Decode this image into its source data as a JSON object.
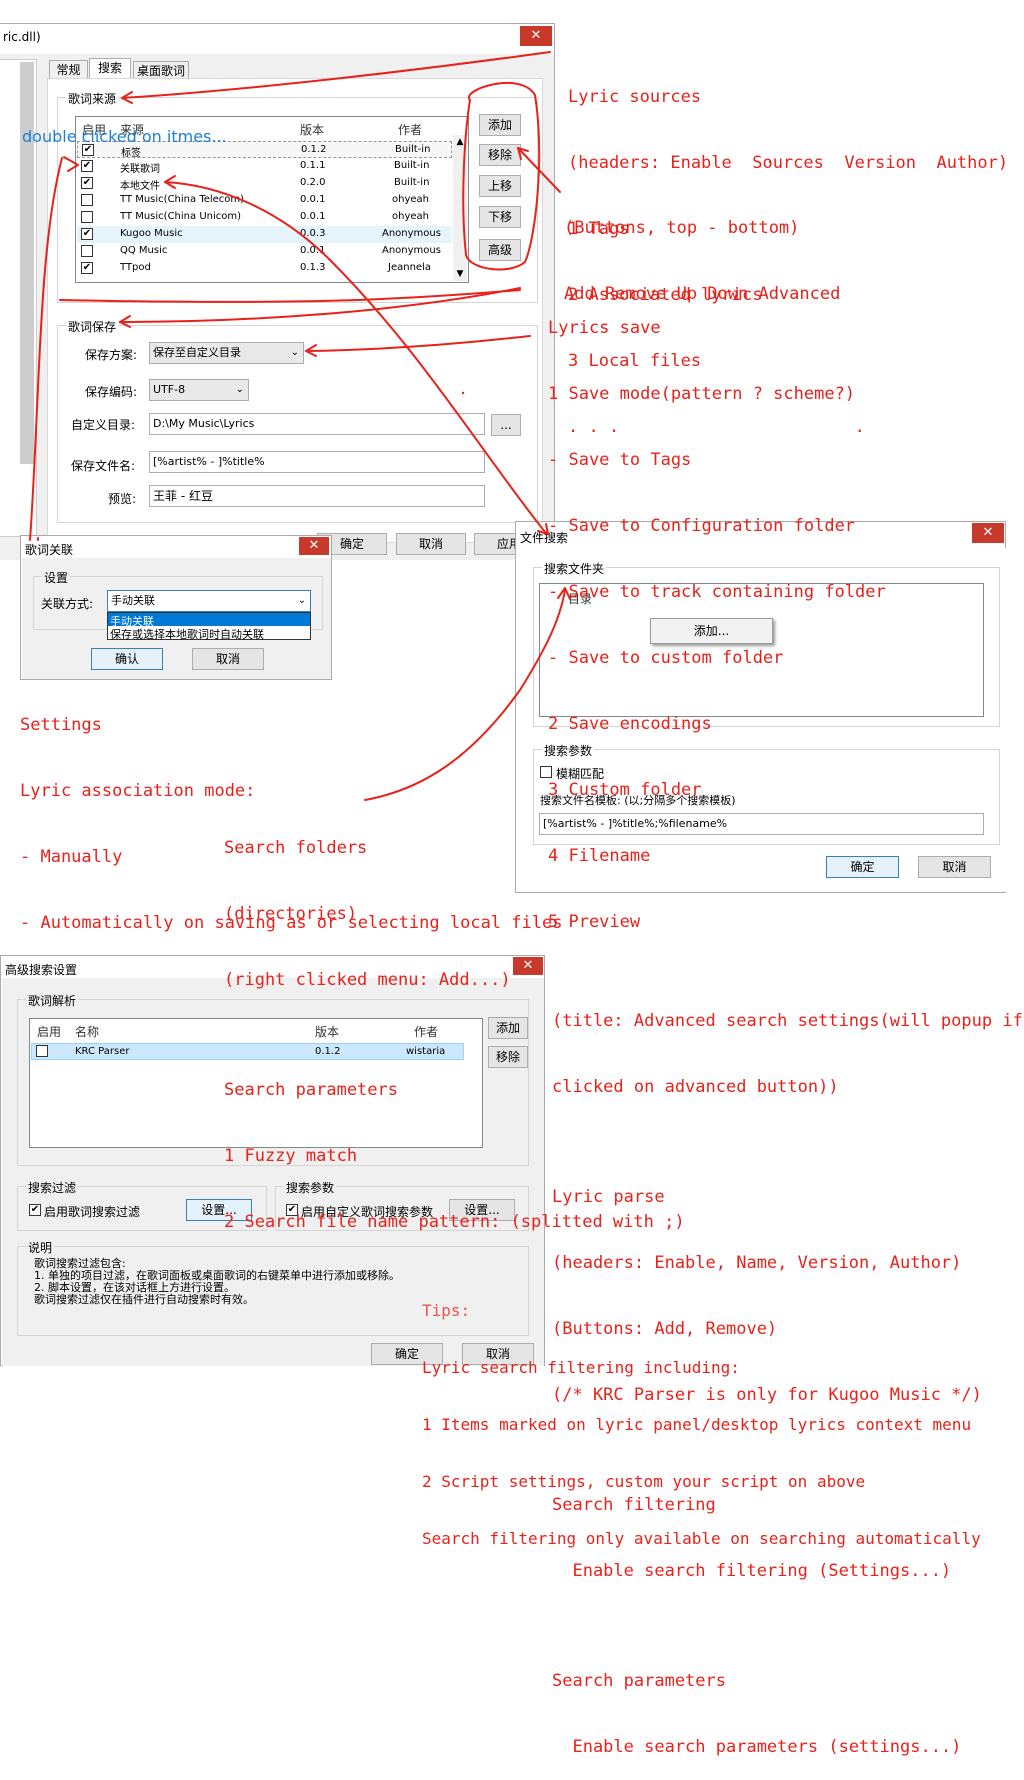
{
  "main_window": {
    "title": "ric.dll)",
    "tabs": [
      "常规",
      "搜索",
      "桌面歌词"
    ],
    "lyric_sources": {
      "group_label": "歌词来源",
      "headers": [
        "启用",
        "来源",
        "版本",
        "作者"
      ],
      "rows": [
        {
          "enabled": true,
          "name": "标签",
          "version": "0.1.2",
          "author": "Built-in"
        },
        {
          "enabled": true,
          "name": "关联歌词",
          "version": "0.1.1",
          "author": "Built-in"
        },
        {
          "enabled": true,
          "name": "本地文件",
          "version": "0.2.0",
          "author": "Built-in"
        },
        {
          "enabled": false,
          "name": "TT Music(China Telecom)",
          "version": "0.0.1",
          "author": "ohyeah"
        },
        {
          "enabled": false,
          "name": "TT Music(China Unicom)",
          "version": "0.0.1",
          "author": "ohyeah"
        },
        {
          "enabled": true,
          "name": "Kugoo Music",
          "version": "0.0.3",
          "author": "Anonymous"
        },
        {
          "enabled": false,
          "name": "QQ Music",
          "version": "0.0.1",
          "author": "Anonymous"
        },
        {
          "enabled": true,
          "name": "TTpod",
          "version": "0.1.3",
          "author": "Jeannela"
        }
      ],
      "buttons": [
        "添加",
        "移除",
        "上移",
        "下移",
        "高级"
      ]
    },
    "lyric_save": {
      "group_label": "歌词保存",
      "scheme_label": "保存方案:",
      "scheme_value": "保存至自定义目录",
      "encoding_label": "保存编码:",
      "encoding_value": "UTF-8",
      "folder_label": "自定义目录:",
      "folder_value": "D:\\My Music\\Lyrics",
      "browse_label": "...",
      "filename_label": "保存文件名:",
      "filename_value": "[%artist% - ]%title%",
      "preview_label": "预览:",
      "preview_value": "王菲 - 红豆"
    },
    "buttons": {
      "ok": "确定",
      "cancel": "取消",
      "apply": "应用"
    }
  },
  "assoc_dialog": {
    "title": "歌词关联",
    "group_label": "设置",
    "mode_label": "关联方式:",
    "mode_value": "手动关联",
    "options": [
      "手动关联",
      "保存或选择本地歌词时自动关联"
    ],
    "ok": "确认",
    "cancel": "取消"
  },
  "file_search_dialog": {
    "title": "文件搜索",
    "folders_group": "搜索文件夹",
    "folders_header": "目录",
    "add_menu": "添加...",
    "params_group": "搜索参数",
    "fuzzy_label": "模糊匹配",
    "pattern_label": "搜索文件名模板: (以;分隔多个搜索模板)",
    "pattern_value": "[%artist% - ]%title%;%filename%",
    "ok": "确定",
    "cancel": "取消"
  },
  "advanced_dialog": {
    "title": "高级搜索设置",
    "parse_group": "歌词解析",
    "headers": [
      "启用",
      "名称",
      "版本",
      "作者"
    ],
    "rows": [
      {
        "enabled": false,
        "name": "KRC Parser",
        "version": "0.1.2",
        "author": "wistaria"
      }
    ],
    "add": "添加",
    "remove": "移除",
    "filter_group": "搜索过滤",
    "filter_label": "启用歌词搜索过滤",
    "filter_settings": "设置...",
    "params_group": "搜索参数",
    "params_label": "启用自定义歌词搜索参数",
    "params_settings": "设置...",
    "desc_group": "说明",
    "desc_lines": [
      "歌词搜索过滤包含:",
      "1. 单独的项目过滤，在歌词面板或桌面歌词的右键菜单中进行添加或移除。",
      "2. 脚本设置，在该对话框上方进行设置。",
      "歌词搜索过滤仅在插件进行自动搜索时有效。"
    ],
    "ok": "确定",
    "cancel": "取消"
  },
  "annotations": {
    "double_click": "double clicked on itmes...",
    "lyric_sources": [
      "Lyric sources",
      "(headers: Enable  Sources  Version  Author)",
      "1 Tags",
      "2 Associated lyrics",
      "3 Local files",
      ". . .                       ."
    ],
    "buttons": [
      "(Buttons, top - bottom)",
      "Add Remove Up Down Advanced"
    ],
    "lyrics_save": [
      "Lyrics save",
      "1 Save mode(pattern ? scheme?)",
      "- Save to Tags",
      "- Save to Configuration folder",
      "- Save to track containing folder",
      "- Save to custom folder",
      "2 Save encodings",
      "3 Custom folder",
      "4 Filename",
      "5 Preview"
    ],
    "settings": [
      "Settings",
      "Lyric association mode:",
      "- Manually",
      "- Automatically on saving as or selecting local files"
    ],
    "search_folders": [
      "Search folders",
      "(directories)",
      "(right clicked menu: Add...)",
      "",
      "Search parameters",
      "1 Fuzzy match",
      "2 Search file name pattern: (splitted with ;)"
    ],
    "advanced": [
      "(title: Advanced search settings(will popup if",
      "clicked on advanced button))",
      "",
      "Lyric parse",
      "(headers: Enable, Name, Version, Author)",
      "(Buttons: Add, Remove)",
      "(/* KRC Parser is only for Kugoo Music */)",
      "",
      "Search filtering",
      "  Enable search filtering (Settings...)",
      "",
      "Search parameters",
      "  Enable search parameters (settings...)"
    ],
    "tips": [
      "Tips:",
      "Lyric search filtering including:",
      "1 Items marked on lyric panel/desktop lyrics context menu",
      "2 Script settings, custom your script on above",
      "Search filtering only available on searching automatically"
    ]
  },
  "colors": {
    "annotation": "#e8211b",
    "close": "#c7392b",
    "selection": "#cce8ff",
    "link": "#1e7fd6"
  }
}
